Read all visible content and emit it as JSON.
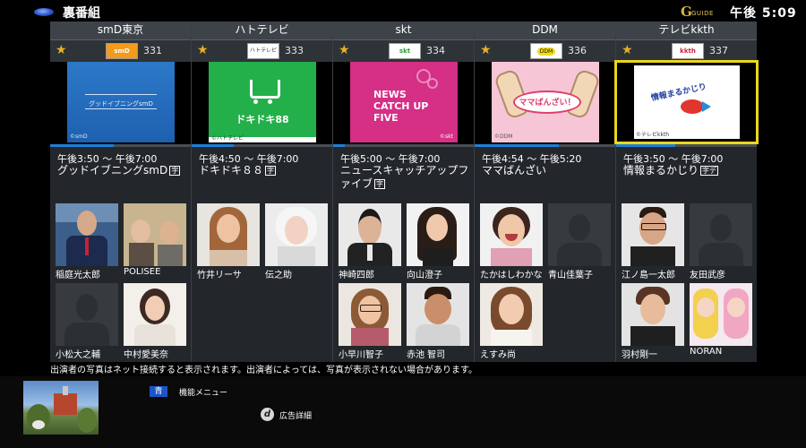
{
  "app": {
    "title": "裏番組",
    "clock": "午後 5:09",
    "brand_letter": "G",
    "brand_sub": "GUIDE"
  },
  "channels": [
    {
      "name": "smD東京",
      "logo_text": "smD",
      "number": "331",
      "thumb_caption": "グッドイブニングsmD",
      "thumb_footer": "©smD",
      "progress_pct": 45,
      "time": "午後3:50 〜 午後7:00",
      "title": "グッドイブニングsmD",
      "badge": "字",
      "cast": [
        {
          "name": "稲庭光太郎",
          "has_photo": true
        },
        {
          "name": "POLISEE",
          "has_photo": true
        },
        {
          "name": "小松大之輔",
          "has_photo": false
        },
        {
          "name": "中村愛美奈",
          "has_photo": true
        }
      ]
    },
    {
      "name": "ハトテレビ",
      "logo_text": "ハトテレビ",
      "number": "333",
      "thumb_caption": "ドキドキ88",
      "thumb_footer": "©ハトテレビ",
      "progress_pct": 30,
      "time": "午後4:50 〜 午後7:00",
      "title": "ドキドキ８８",
      "badge": "字",
      "cast": [
        {
          "name": "竹井リーサ",
          "has_photo": true
        },
        {
          "name": "伝之助",
          "has_photo": true
        }
      ]
    },
    {
      "name": "skt",
      "logo_text": "skt",
      "number": "334",
      "thumb_caption": "NEWS CATCH UP FIVE",
      "thumb_footer": "©skt",
      "progress_pct": 8,
      "time": "午後5:00 〜 午後7:00",
      "title": "ニュースキャッチアップファイブ",
      "badge": "字",
      "cast": [
        {
          "name": "神崎四郎",
          "has_photo": true
        },
        {
          "name": "向山澄子",
          "has_photo": true
        },
        {
          "name": "小早川智子",
          "has_photo": true
        },
        {
          "name": "赤池 智司",
          "has_photo": true
        }
      ]
    },
    {
      "name": "DDM",
      "logo_text": "DDM",
      "number": "336",
      "thumb_caption": "ママばんざい！",
      "thumb_footer": "©DDM",
      "progress_pct": 60,
      "time": "午後4:54 〜 午後5:20",
      "title": "ママばんざい",
      "badge": "",
      "cast": [
        {
          "name": "たかはしわかな",
          "has_photo": true
        },
        {
          "name": "青山佳葉子",
          "has_photo": false
        },
        {
          "name": "えすみ尚",
          "has_photo": true
        }
      ]
    },
    {
      "name": "テレビkkth",
      "logo_text": "kkth",
      "number": "337",
      "thumb_caption": "情報まるかじり",
      "thumb_footer": "©テレビkkth",
      "progress_pct": 42,
      "time": "午後3:50 〜 午後7:00",
      "title": "情報まるかじり",
      "badge": "字デ",
      "cast": [
        {
          "name": "江ノ島一太郎",
          "has_photo": true
        },
        {
          "name": "友田武彦",
          "has_photo": false
        },
        {
          "name": "羽村剛一",
          "has_photo": true
        },
        {
          "name": "NORAN",
          "has_photo": true
        }
      ]
    }
  ],
  "notice": "出演者の写真はネット接続すると表示されます。出演者によっては、写真が表示されない場合があります。",
  "bottom": {
    "blue_key": "青",
    "menu_label": "機能メニュー",
    "d_key": "d",
    "ad_label": "広告詳細"
  },
  "colors": {
    "star": "#e9b021",
    "progress": "#1f7fd6",
    "selected": "#ecd61d",
    "blue_key": "#1d55c7"
  }
}
